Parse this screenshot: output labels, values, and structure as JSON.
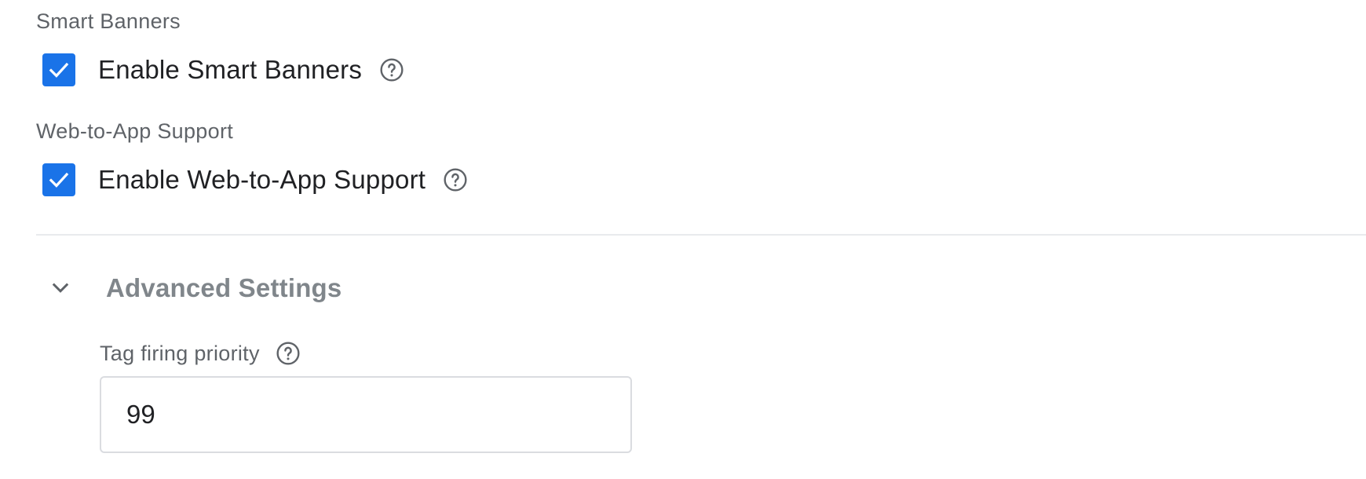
{
  "colors": {
    "checkbox_accent": "#1a73e8",
    "label_gray": "#5f6368",
    "heading_gray": "#80868b",
    "divider": "#e8eaed"
  },
  "smart_banners": {
    "section_label": "Smart Banners",
    "checkbox_label": "Enable Smart Banners",
    "checked": true,
    "help_icon": "help-circle-icon"
  },
  "web_to_app": {
    "section_label": "Web-to-App Support",
    "checkbox_label": "Enable Web-to-App Support",
    "checked": true,
    "help_icon": "help-circle-icon"
  },
  "advanced": {
    "title": "Advanced Settings",
    "expanded": true,
    "chevron_icon": "chevron-down-icon",
    "tag_firing_priority": {
      "label": "Tag firing priority",
      "value": "99",
      "help_icon": "help-circle-icon"
    }
  }
}
